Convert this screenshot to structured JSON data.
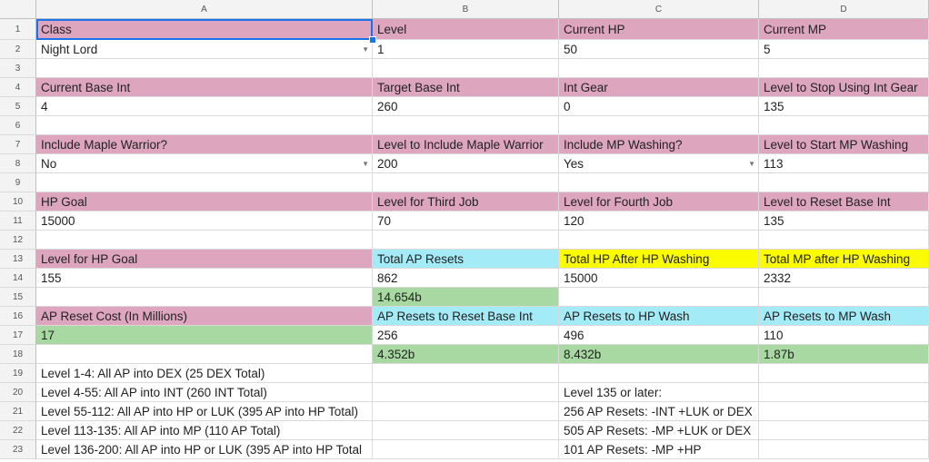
{
  "columns": [
    "A",
    "B",
    "C",
    "D"
  ],
  "rows": [
    "1",
    "2",
    "3",
    "4",
    "5",
    "6",
    "7",
    "8",
    "9",
    "10",
    "11",
    "12",
    "13",
    "14",
    "15",
    "16",
    "17",
    "18",
    "19",
    "20",
    "21",
    "22",
    "23"
  ],
  "cells": {
    "A1": "Class",
    "B1": "Level",
    "C1": "Current HP",
    "D1": "Current MP",
    "A2": "Night Lord",
    "B2": "1",
    "C2": "50",
    "D2": "5",
    "A4": "Current Base Int",
    "B4": "Target Base Int",
    "C4": "Int Gear",
    "D4": "Level to Stop Using Int Gear",
    "A5": "4",
    "B5": "260",
    "C5": "0",
    "D5": "135",
    "A7": "Include Maple Warrior?",
    "B7": "Level to Include Maple Warrior",
    "C7": "Include MP Washing?",
    "D7": "Level to Start MP Washing",
    "A8": "No",
    "B8": "200",
    "C8": "Yes",
    "D8": "113",
    "A10": "HP Goal",
    "B10": "Level for Third Job",
    "C10": "Level for Fourth Job",
    "D10": "Level to Reset Base Int",
    "A11": "15000",
    "B11": "70",
    "C11": "120",
    "D11": "135",
    "A13": "Level for HP Goal",
    "B13": "Total AP Resets",
    "C13": "Total HP After HP Washing",
    "D13": "Total MP after HP Washing",
    "A14": "155",
    "B14": "862",
    "C14": "15000",
    "D14": "2332",
    "B15": "14.654b",
    "A16": "AP Reset Cost (In Millions)",
    "B16": "AP Resets to Reset Base Int",
    "C16": "AP Resets to HP Wash",
    "D16": "AP Resets to MP Wash",
    "A17": "17",
    "B17": "256",
    "C17": "496",
    "D17": "110",
    "B18": "4.352b",
    "C18": "8.432b",
    "D18": "1.87b",
    "A19": "Level 1-4: All AP into DEX (25 DEX Total)",
    "A20": "Level 4-55: All AP into INT (260 INT Total)",
    "C20": "Level 135 or later:",
    "A21": "Level 55-112: All AP into HP or LUK (395 AP into HP Total)",
    "C21": "256 AP Resets: -INT +LUK or DEX",
    "A22": "Level 113-135: All AP into MP (110 AP Total)",
    "C22": "505 AP Resets: -MP +LUK or DEX",
    "A23": "Level 136-200: All AP into HP or LUK (395 AP into HP Total",
    "C23": "101 AP Resets: -MP +HP"
  },
  "colors": {
    "label": "#dea5bf",
    "result_cyan": "#a3ebf7",
    "result_yellow": "#fcfc00",
    "result_green": "#a8d9a2",
    "selection": "#1a73e8"
  },
  "fills": {
    "pink": [
      "A1",
      "B1",
      "C1",
      "D1",
      "A4",
      "B4",
      "C4",
      "D4",
      "A7",
      "B7",
      "C7",
      "D7",
      "A10",
      "B10",
      "C10",
      "D10",
      "A13",
      "A16"
    ],
    "cyan": [
      "B13",
      "B16",
      "C16",
      "D16"
    ],
    "yellow": [
      "C13",
      "D13"
    ],
    "green": [
      "B15",
      "A17",
      "B18",
      "C18",
      "D18"
    ]
  },
  "dropdowns": [
    "A2",
    "A8",
    "C8"
  ],
  "selected_cell": "A1",
  "icons": {
    "dropdown": "triangle-down-icon"
  }
}
